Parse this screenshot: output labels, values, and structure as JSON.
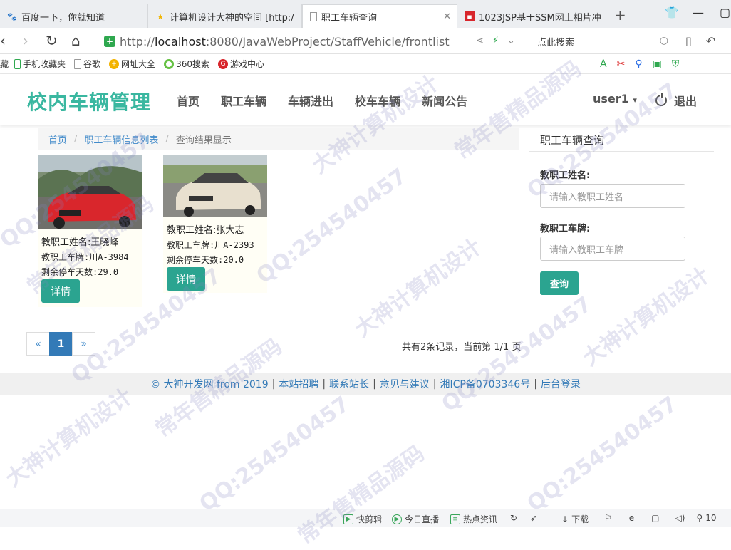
{
  "browser": {
    "tabs": [
      {
        "label": "百度一下，你就知道"
      },
      {
        "label": "计算机设计大神的空间 [http:/"
      },
      {
        "label": "职工车辆查询"
      },
      {
        "label": "1023JSP基于SSM网上相片冲"
      }
    ],
    "url_prefix": "http://",
    "url_host": "localhost",
    "url_path": ":8080/JavaWebProject/StaffVehicle/frontlist",
    "search_placeholder": "点此搜索",
    "bookmarks": [
      "手机收藏夹",
      "谷歌",
      "网址大全",
      "360搜索",
      "游戏中心"
    ],
    "bookmark_prefix": "藏"
  },
  "site": {
    "brand": "校内车辆管理",
    "nav": [
      "首页",
      "职工车辆",
      "车辆进出",
      "校车车辆",
      "新闻公告"
    ],
    "user": "user1",
    "logout": "退出"
  },
  "breadcrumb": {
    "home": "首页",
    "list": "职工车辆信息列表",
    "current": "查询结果显示",
    "separator": "/"
  },
  "cards": [
    {
      "name_line": "教职工姓名:王晓峰",
      "plate_line": "教职工车牌:川A-3984",
      "days_line": "剩余停车天数:29.0",
      "button": "详情",
      "car_color": "#d9262c"
    },
    {
      "name_line": "教职工姓名:张大志",
      "plate_line": "教职工车牌:川A-2393",
      "days_line": "剩余停车天数:20.0",
      "button": "详情",
      "car_color": "#e8e0cf"
    }
  ],
  "pagination": {
    "prev": "«",
    "current": "1",
    "next": "»",
    "summary": "共有2条记录，当前第 1/1 页"
  },
  "search_panel": {
    "title": "职工车辆查询",
    "name_label": "教职工姓名:",
    "name_placeholder": "请输入教职工姓名",
    "plate_label": "教职工车牌:",
    "plate_placeholder": "请输入教职工车牌",
    "submit": "查询"
  },
  "footer": {
    "links": [
      "© 大神开发网 from 2019",
      "本站招聘",
      "联系站长",
      "意见与建议",
      "湘ICP备0703346号",
      "后台登录"
    ]
  },
  "statusbar": {
    "items": [
      "快剪辑",
      "今日直播",
      "热点资讯",
      "下载",
      "10"
    ]
  },
  "watermarks": [
    "QQ:254540457",
    "大神计算机设计",
    "常年售精品源码"
  ],
  "colors": {
    "brand": "#3ab7a0",
    "button": "#2ba490",
    "link": "#337ab7"
  }
}
